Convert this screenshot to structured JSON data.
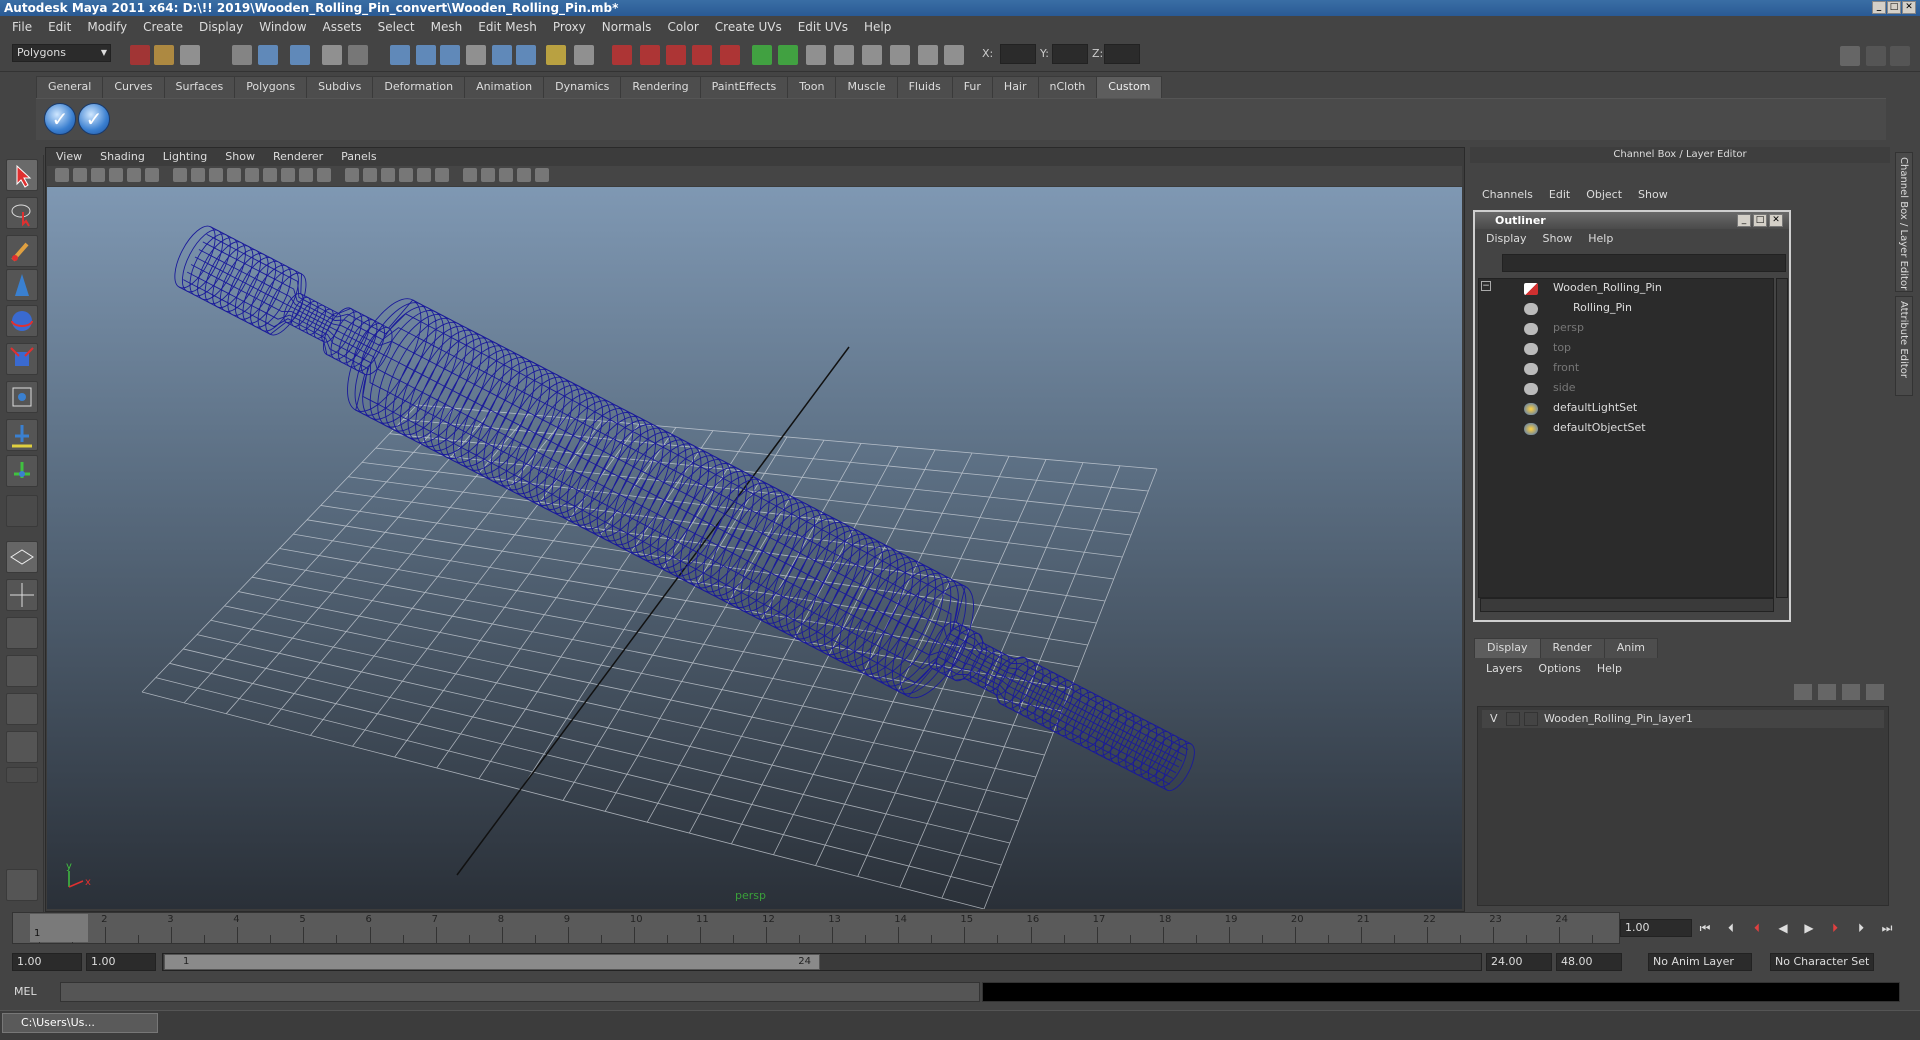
{
  "window": {
    "title": "Autodesk Maya 2011 x64: D:\\!! 2019\\Wooden_Rolling_Pin_convert\\Wooden_Rolling_Pin.mb*",
    "min": "_",
    "max": "□",
    "close": "✕"
  },
  "menu": [
    "File",
    "Edit",
    "Modify",
    "Create",
    "Display",
    "Window",
    "Assets",
    "Select",
    "Mesh",
    "Edit Mesh",
    "Proxy",
    "Normals",
    "Color",
    "Create UVs",
    "Edit UVs",
    "Help"
  ],
  "status": {
    "mode": "Polygons",
    "x_label": "X:",
    "y_label": "Y:",
    "z_label": "Z:"
  },
  "shelf": {
    "tabs": [
      "General",
      "Curves",
      "Surfaces",
      "Polygons",
      "Subdivs",
      "Deformation",
      "Animation",
      "Dynamics",
      "Rendering",
      "PaintEffects",
      "Toon",
      "Muscle",
      "Fluids",
      "Fur",
      "Hair",
      "nCloth",
      "Custom"
    ],
    "active": "Custom",
    "buttons": [
      "check-button",
      "check-button"
    ]
  },
  "viewport": {
    "menu": [
      "View",
      "Shading",
      "Lighting",
      "Show",
      "Renderer",
      "Panels"
    ],
    "camera_label": "persp",
    "axis_y": "y",
    "axis_x": "x",
    "wire_color": "#0a0a8a"
  },
  "channelbox": {
    "title": "Channel Box / Layer Editor",
    "menu": [
      "Channels",
      "Edit",
      "Object",
      "Show"
    ]
  },
  "outliner": {
    "title": "Outliner",
    "menu": [
      "Display",
      "Show",
      "Help"
    ],
    "items": [
      {
        "label": "Wooden_Rolling_Pin",
        "dim": false
      },
      {
        "label": "Rolling_Pin",
        "dim": false
      },
      {
        "label": "persp",
        "dim": true
      },
      {
        "label": "top",
        "dim": true
      },
      {
        "label": "front",
        "dim": true
      },
      {
        "label": "side",
        "dim": true
      },
      {
        "label": "defaultLightSet",
        "dim": false
      },
      {
        "label": "defaultObjectSet",
        "dim": false
      }
    ]
  },
  "layers": {
    "tabs": [
      "Display",
      "Render",
      "Anim"
    ],
    "active": "Display",
    "menu": [
      "Layers",
      "Options",
      "Help"
    ],
    "rows": [
      {
        "visible": "V",
        "name": "Wooden_Rolling_Pin_layer1"
      }
    ]
  },
  "side_tabs": [
    "Channel Box / Layer Editor",
    "Attribute Editor"
  ],
  "timeline": {
    "ticks": [
      "1",
      "2",
      "3",
      "4",
      "5",
      "6",
      "7",
      "8",
      "9",
      "10",
      "11",
      "12",
      "13",
      "14",
      "15",
      "16",
      "17",
      "18",
      "19",
      "20",
      "21",
      "22",
      "23",
      "24"
    ],
    "start_marker": "1",
    "current": "1.00"
  },
  "range": {
    "start": "1.00",
    "start2": "1.00",
    "thumb_start": "1",
    "thumb_end": "24",
    "end": "24.00",
    "end2": "48.00",
    "anim_layer": "No Anim Layer",
    "char_set": "No Character Set"
  },
  "cmd": {
    "label": "MEL"
  },
  "taskbar": {
    "item": "C:\\Users\\Us..."
  }
}
